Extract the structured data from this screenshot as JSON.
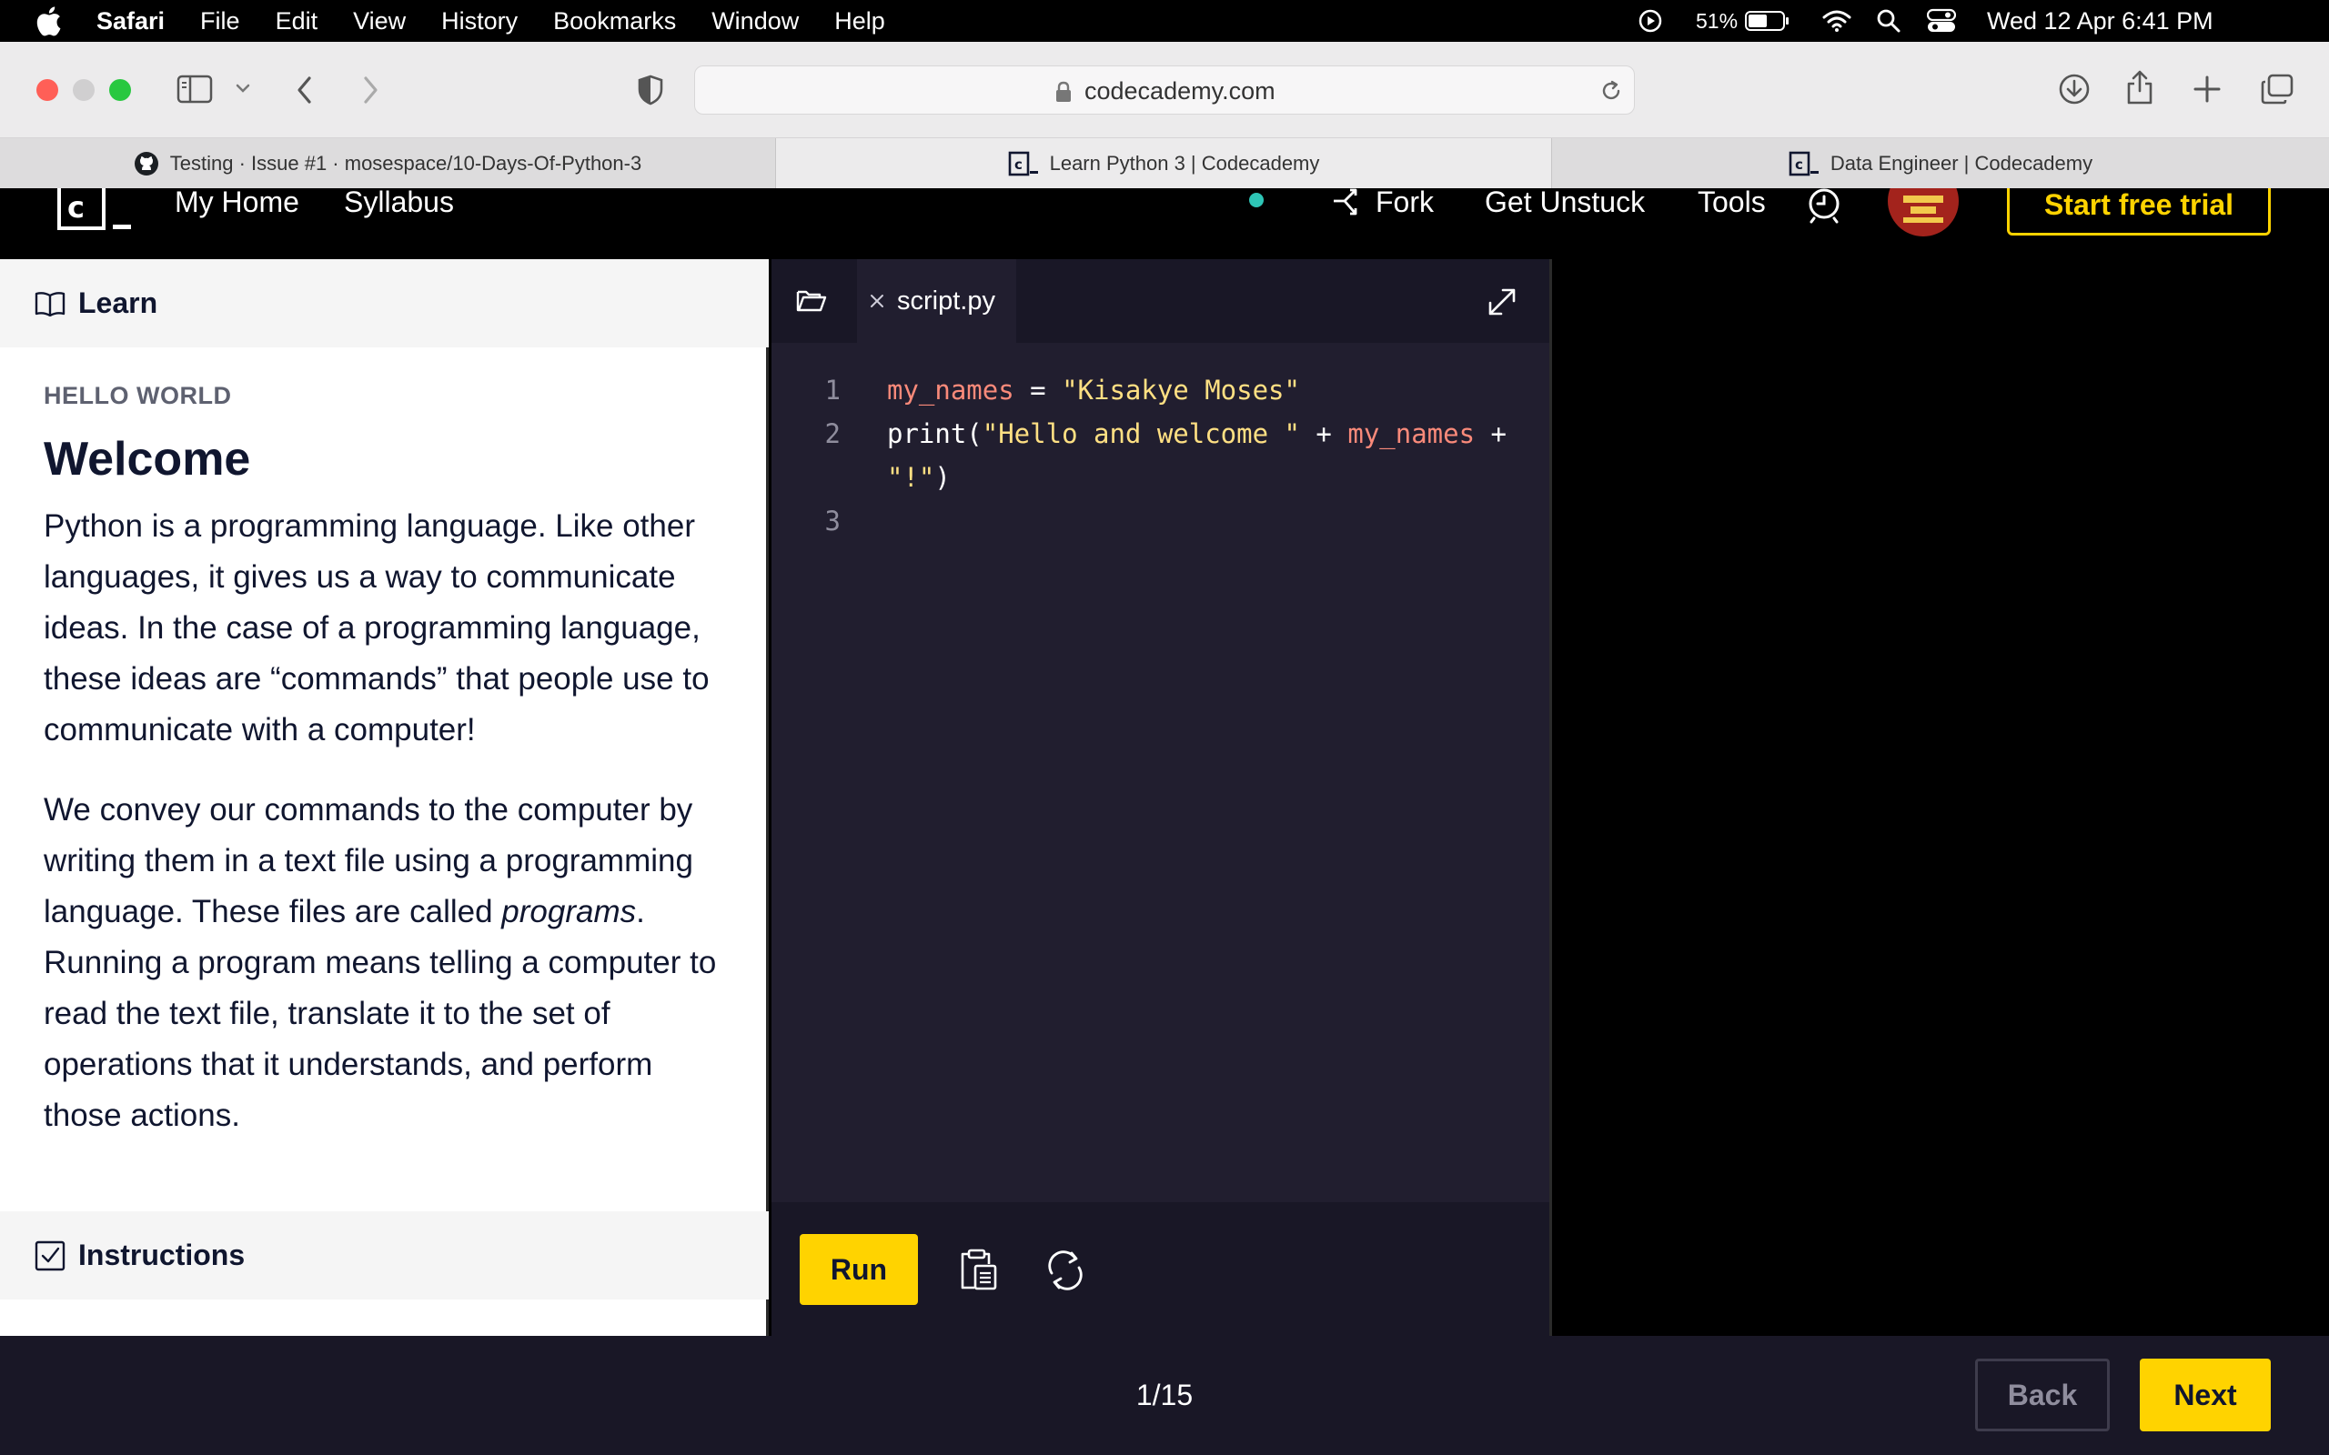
{
  "menubar": {
    "app_name": "Safari",
    "menus": [
      "File",
      "Edit",
      "View",
      "History",
      "Bookmarks",
      "Window",
      "Help"
    ],
    "battery": "51%",
    "datetime": "Wed 12 Apr  6:41 PM"
  },
  "browser": {
    "url": "codecademy.com",
    "tabs": [
      {
        "title": "Testing · Issue #1 · mosespace/10-Days-Of-Python-3",
        "favicon": "github-icon",
        "active": false
      },
      {
        "title": "Learn Python 3 | Codecademy",
        "favicon": "codecademy-icon",
        "active": true
      },
      {
        "title": "Data Engineer | Codecademy",
        "favicon": "codecademy-icon",
        "active": false
      }
    ]
  },
  "header": {
    "nav": [
      "My Home",
      "Syllabus"
    ],
    "fork_label": "Fork",
    "get_unstuck_label": "Get Unstuck",
    "tools_label": "Tools",
    "trial_label": "Start free trial"
  },
  "learn_panel": {
    "header_label": "Learn",
    "eyebrow": "HELLO WORLD",
    "title": "Welcome",
    "paragraph1": "Python is a programming language. Like other languages, it gives us a way to communicate ideas. In the case of a programming language, these ideas are “commands” that people use to communicate with a computer!",
    "paragraph2_before": "We convey our commands to the computer by writing them in a text file using a programming language. These files are called ",
    "paragraph2_em": "programs",
    "paragraph2_after": ". Running a program means telling a computer to read the text file, translate it to the set of operations that it understands, and perform those actions.",
    "instructions_label": "Instructions"
  },
  "editor": {
    "filename": "script.py",
    "line_numbers": [
      "1",
      "2",
      "",
      "3"
    ],
    "line1": {
      "var": "my_names",
      "op": " = ",
      "str": "\"Kisakye Moses\""
    },
    "line2": {
      "fn": "print(",
      "str": "\"Hello and welcome \"",
      "op1": " + ",
      "var": "my_names",
      "op2": " +"
    },
    "line2_wrap": {
      "str": "\"!\"",
      "close": ")"
    },
    "run_label": "Run"
  },
  "footer": {
    "progress": "1/15",
    "back_label": "Back",
    "next_label": "Next"
  },
  "colors": {
    "accent_yellow": "#ffd300",
    "editor_bg": "#211e2f",
    "code_variable": "#fa8a7a",
    "code_string": "#ffe083"
  }
}
